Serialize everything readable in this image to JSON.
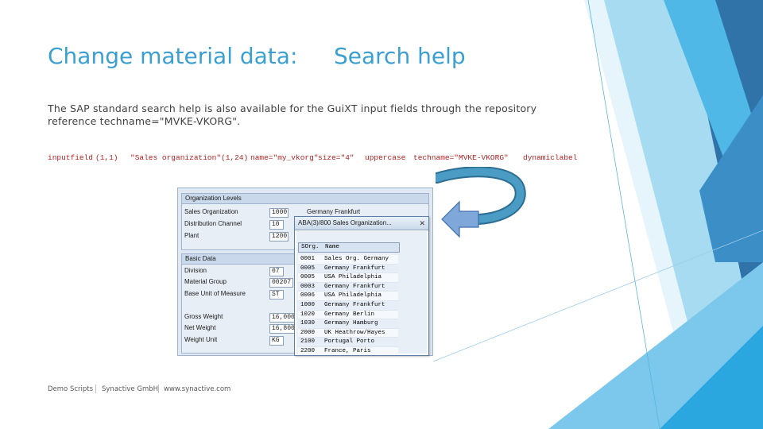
{
  "slide": {
    "title_left": "Change material data:",
    "title_right": "Search help",
    "body": "The SAP standard search help is also available for the GuiXT input fields through the repository reference techname=\"MVKE-VKORG\".",
    "code": {
      "keyword": "inputfield",
      "pos1": "(1,1)",
      "label": "\"Sales organization\"",
      "pos2": "(1,24)",
      "name": "name=\"my_vkorg\"",
      "size": "size=\"4\"",
      "uppercase": "uppercase",
      "techname": "techname=\"MVKE-VKORG\"",
      "dynamiclabel": "dynamiclabel"
    }
  },
  "screenshot": {
    "org_group": {
      "title": "Organization Levels",
      "rows": [
        {
          "label": "Sales Organization",
          "value": "1000",
          "text": "Germany Frankfurt"
        },
        {
          "label": "Distribution Channel",
          "value": "10",
          "text": ""
        },
        {
          "label": "Plant",
          "value": "1200",
          "text": ""
        }
      ]
    },
    "basic_group": {
      "title": "Basic Data",
      "rows": [
        {
          "label": "Division",
          "value": "07"
        },
        {
          "label": "Material Group",
          "value": "00207"
        },
        {
          "label": "Base Unit of Measure",
          "value": "ST"
        },
        {
          "label": "Gross Weight",
          "value": "16,000"
        },
        {
          "label": "Net Weight",
          "value": "16,800"
        },
        {
          "label": "Weight Unit",
          "value": "KG"
        }
      ]
    },
    "popup": {
      "title": "ABA(3)/800 Sales Organization...",
      "close": "✕",
      "columns": [
        "SOrg.",
        "Name"
      ],
      "rows": [
        {
          "code": "0001",
          "name": "Sales Org. Germany"
        },
        {
          "code": "0005",
          "name": "Germany Frankfurt"
        },
        {
          "code": "0005",
          "name": "USA Philadelphia"
        },
        {
          "code": "0003",
          "name": "Germany Frankfurt"
        },
        {
          "code": "0006",
          "name": "USA Philadelphia"
        },
        {
          "code": "1000",
          "name": "Germany Frankfurt"
        },
        {
          "code": "1020",
          "name": "Germany Berlin"
        },
        {
          "code": "1030",
          "name": "Germany Hamburg"
        },
        {
          "code": "2000",
          "name": "UK Heathrow/Hayes"
        },
        {
          "code": "2100",
          "name": "Portugal Porto"
        },
        {
          "code": "2200",
          "name": "France, Paris"
        }
      ]
    }
  },
  "footer": {
    "left": "Demo Scripts",
    "middle": "Synactive GmbH",
    "right": "www.synactive.com"
  },
  "colors": {
    "title": "#3aa0d2",
    "code": "#b22222",
    "arrow_fill": "#7fa7d9",
    "curve": "#4a90b5"
  }
}
